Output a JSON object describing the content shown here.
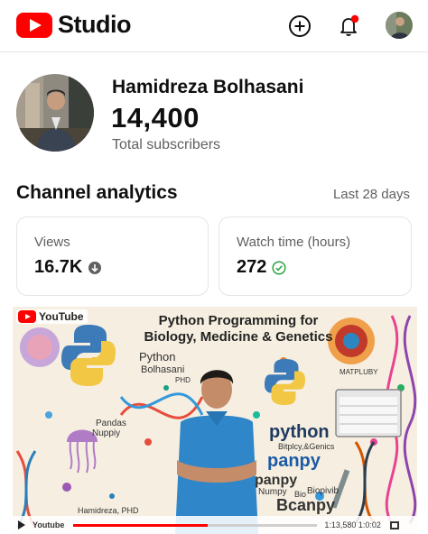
{
  "header": {
    "logo_text": "Studio",
    "brand_color": "#ff0000",
    "actions": [
      {
        "icon": "create-plus-icon"
      },
      {
        "icon": "notification-bell-icon",
        "has_badge": true
      },
      {
        "icon": "account-avatar"
      }
    ]
  },
  "channel": {
    "name": "Hamidreza Bolhasani",
    "subscribers": "14,400",
    "subscribers_label": "Total subscribers"
  },
  "analytics": {
    "title": "Channel analytics",
    "range": "Last 28 days",
    "cards": [
      {
        "label": "Views",
        "value": "16.7K",
        "trend_icon": "arrow-down-circle-icon"
      },
      {
        "label": "Watch time (hours)",
        "value": "272",
        "trend_icon": "check-circle-icon"
      }
    ]
  },
  "thumbnail": {
    "platform_label": "YouTube",
    "title_line1": "Python Programming for",
    "title_line2": "Biology, Medicine & Genetics",
    "left_python": "Python",
    "left_name": "Bolhasani",
    "left_degree": "PHD",
    "pandas": "Pandas",
    "numpy_left": "Nuppiy",
    "matpluby": "MATPLUBY",
    "python_right": "python",
    "biotext": "Bitplcy,&Genics",
    "panpy": "panpy",
    "panpy2": "panpy",
    "numpy": "Numpy",
    "bio": "Bio",
    "biopivib": "Biopivib",
    "bcanpy": "Bcanpy",
    "bottom_name": "Hamidreza, PHD",
    "control_label": "Youtube",
    "control_time": "1:13,580 1:0:02",
    "progress_fraction": 0.55
  }
}
